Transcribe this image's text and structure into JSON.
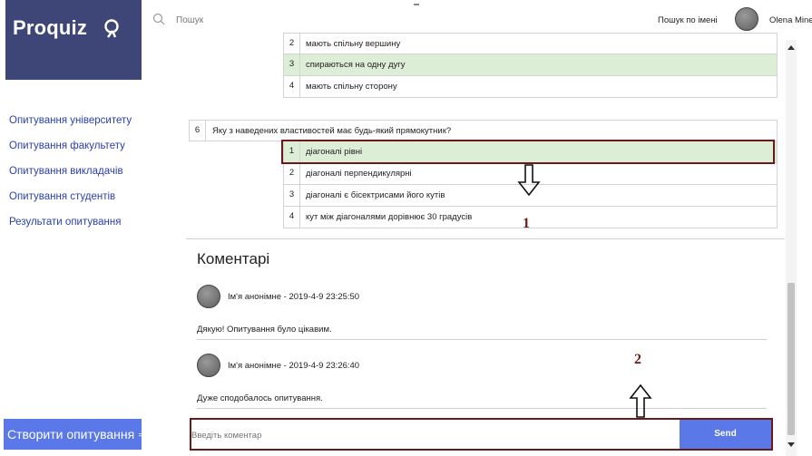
{
  "app": {
    "logo_text": "Proquiz"
  },
  "sidebar": {
    "items": [
      {
        "label": "Опитування університету"
      },
      {
        "label": "Опитування факультету"
      },
      {
        "label": "Опитування викладачів"
      },
      {
        "label": "Опитування студентів"
      },
      {
        "label": "Результати опитування"
      }
    ],
    "create_button": "Створити опитування ⇒"
  },
  "topbar": {
    "search_placeholder": "Пошук",
    "search_by_name": "Пошук по імені",
    "user_name": "Olena Minen"
  },
  "prev_question": {
    "answers": [
      {
        "num": "2",
        "text": "мають спільну вершину"
      },
      {
        "num": "3",
        "text": "спираються на одну дугу"
      },
      {
        "num": "4",
        "text": "мають спільну сторону"
      }
    ]
  },
  "question": {
    "num": "6",
    "text": "Яку з наведених властивостей має будь-який прямокутник?",
    "answers": [
      {
        "num": "1",
        "text": "діагоналі рівні"
      },
      {
        "num": "2",
        "text": "діагоналі перпендикулярні"
      },
      {
        "num": "3",
        "text": "діагоналі є бісектрисами його кутів"
      },
      {
        "num": "4",
        "text": "кут між діагоналями дорівнює 30 градусів"
      }
    ]
  },
  "comments": {
    "title": "Коментарі",
    "items": [
      {
        "author": "Ім'я анонімне - 2019-4-9 23:25:50",
        "text": "Дякую! Опитування було цікавим."
      },
      {
        "author": "Ім'я анонімне - 2019-4-9 23:26:40",
        "text": "Дуже сподобалось опитування."
      }
    ],
    "input_placeholder": "Введіть коментар",
    "send_label": "Send"
  },
  "annotations": {
    "label_1": "1",
    "label_2": "2"
  },
  "colors": {
    "brand": "#3e4677",
    "accent": "#5a78e8",
    "highlight": "#dcefd6",
    "annotation": "#6b1a1a"
  }
}
